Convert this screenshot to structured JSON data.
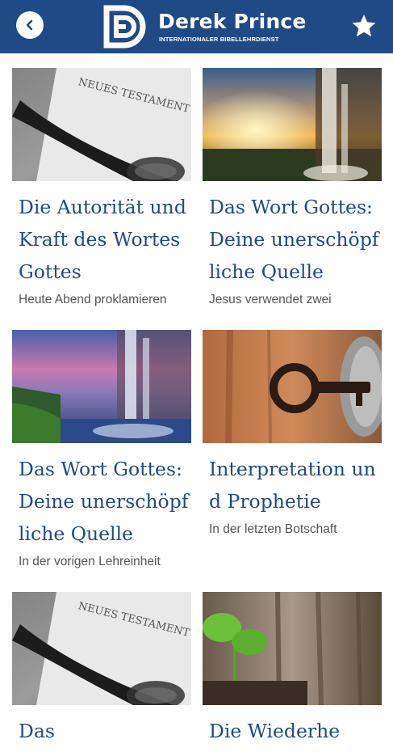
{
  "header": {
    "brand_name": "Derek Prince",
    "brand_subtitle": "INTERNATIONALER BIBELLEHRDIENST",
    "back_icon": "chevron-left-icon",
    "favorite_icon": "star-icon",
    "bar_color": "#1f4a86"
  },
  "cards": [
    {
      "title": "Die Autorität und Kraft des Wortes Gottes",
      "excerpt": "Heute Abend proklamieren",
      "image": "book-magnifier",
      "image_text": "NEUES TESTAMENT"
    },
    {
      "title": "Das Wort Gottes: Deine unerschöpfliche Quelle",
      "excerpt": "Jesus verwendet zwei",
      "image": "waterfall-sunset"
    },
    {
      "title": "Das Wort Gottes: Deine unerschöpfliche Quelle",
      "excerpt": "In der vorigen Lehreinheit",
      "image": "waterfall-dusk"
    },
    {
      "title": "Interpretation und Prophetie",
      "excerpt": "In der letzten Botschaft",
      "image": "key-in-lock"
    },
    {
      "title": "Das",
      "excerpt": "",
      "image": "book-magnifier",
      "image_text": "NEUES TESTAMENT"
    },
    {
      "title": "Die Wiederhe",
      "excerpt": "",
      "image": "sprout-wood"
    }
  ]
}
